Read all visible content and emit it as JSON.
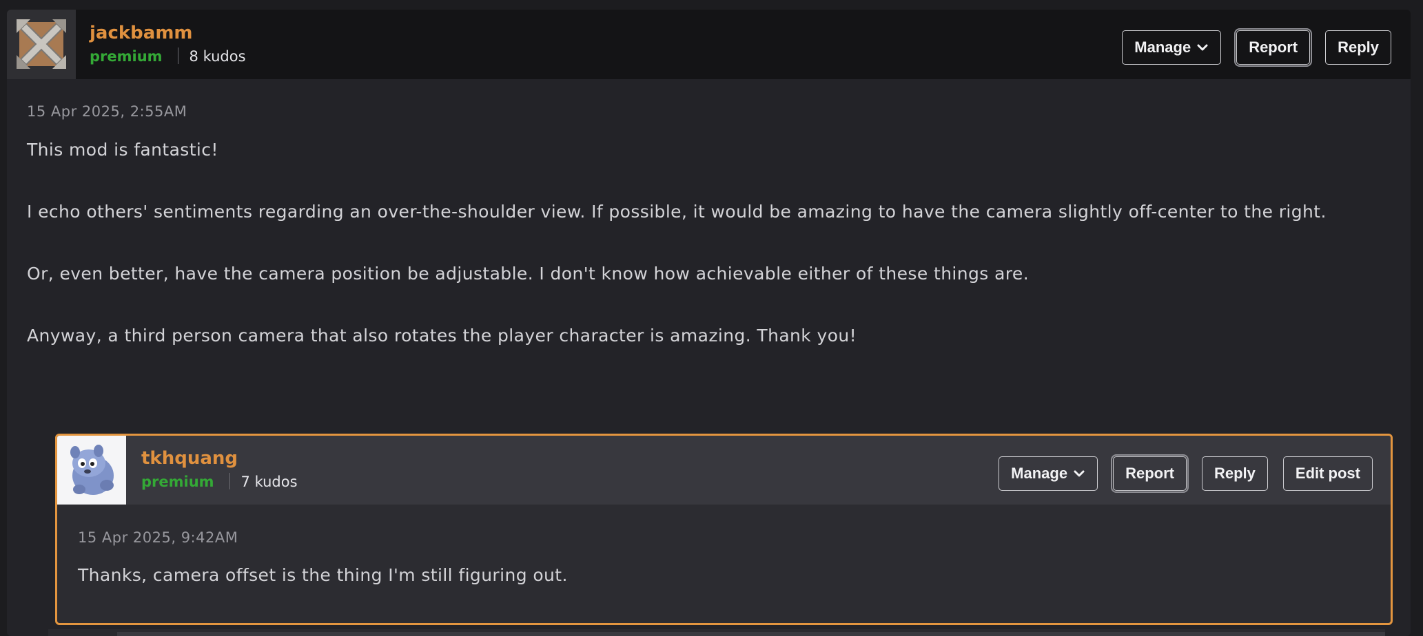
{
  "comment": {
    "author": "jackbamm",
    "badge": "premium",
    "kudos": "8 kudos",
    "timestamp": "15 Apr 2025, 2:55AM",
    "paragraphs": [
      "This mod is fantastic!",
      "I echo others' sentiments regarding an over-the-shoulder view. If possible, it would be amazing to have the camera slightly off-center to the right.",
      "Or, even better, have the camera position be adjustable. I don't know how achievable either of these things are.",
      "Anyway, a third person camera that also rotates the player character is amazing. Thank you!"
    ],
    "actions": {
      "manage": "Manage",
      "report": "Report",
      "reply": "Reply"
    },
    "avatar_icon": "crossed-arrows-logo-icon"
  },
  "reply": {
    "author": "tkhquang",
    "badge": "premium",
    "kudos": "7 kudos",
    "timestamp": "15 Apr 2025, 9:42AM",
    "text": "Thanks, camera offset is the thing I'm still figuring out.",
    "actions": {
      "manage": "Manage",
      "report": "Report",
      "reply": "Reply",
      "edit": "Edit post"
    },
    "avatar_icon": "blue-creature-avatar-icon"
  },
  "colors": {
    "username": "#e0913f",
    "premium": "#34a936",
    "highlight_border": "#e3953f"
  }
}
